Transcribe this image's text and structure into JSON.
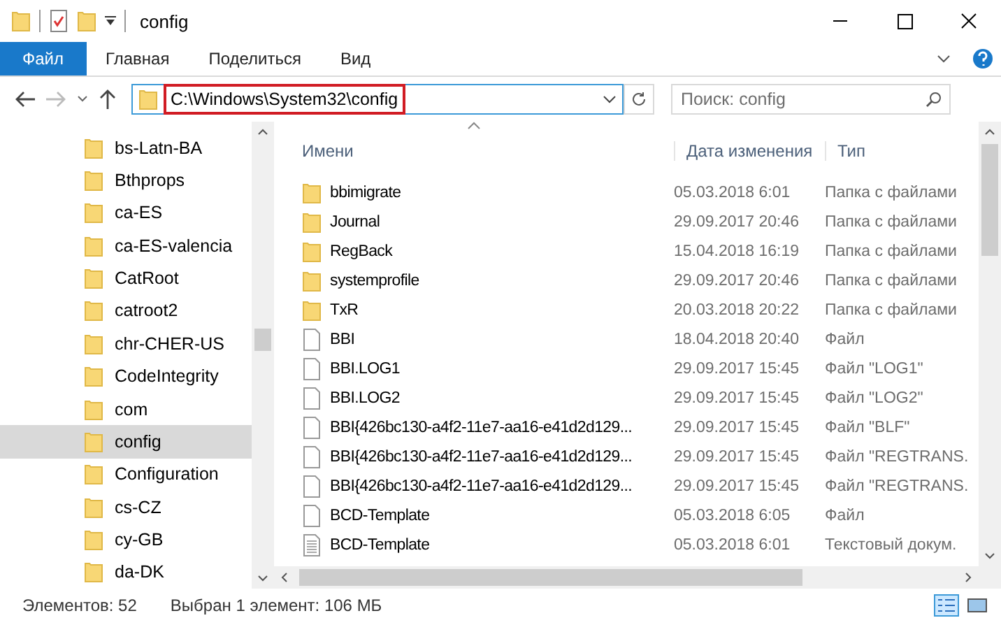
{
  "window": {
    "title": "config"
  },
  "ribbon_tabs": [
    {
      "label": "Файл",
      "selected": true
    },
    {
      "label": "Главная",
      "selected": false
    },
    {
      "label": "Поделиться",
      "selected": false
    },
    {
      "label": "Вид",
      "selected": false
    }
  ],
  "address": {
    "path": "C:\\Windows\\System32\\config",
    "highlighted": true
  },
  "search": {
    "placeholder": "Поиск: config"
  },
  "sidebar": {
    "items": [
      {
        "label": "bs-Latn-BA",
        "selected": false
      },
      {
        "label": "Bthprops",
        "selected": false
      },
      {
        "label": "ca-ES",
        "selected": false
      },
      {
        "label": "ca-ES-valencia",
        "selected": false
      },
      {
        "label": "CatRoot",
        "selected": false
      },
      {
        "label": "catroot2",
        "selected": false
      },
      {
        "label": "chr-CHER-US",
        "selected": false
      },
      {
        "label": "CodeIntegrity",
        "selected": false
      },
      {
        "label": "com",
        "selected": false
      },
      {
        "label": "config",
        "selected": true
      },
      {
        "label": "Configuration",
        "selected": false
      },
      {
        "label": "cs-CZ",
        "selected": false
      },
      {
        "label": "cy-GB",
        "selected": false
      },
      {
        "label": "da-DK",
        "selected": false
      }
    ]
  },
  "table": {
    "columns": [
      "Имени",
      "Дата изменения",
      "Тип"
    ],
    "rows": [
      {
        "kind": "folder",
        "name": "bbimigrate",
        "date": "05.03.2018 6:01",
        "type": "Папка с файлами"
      },
      {
        "kind": "folder",
        "name": "Journal",
        "date": "29.09.2017 20:46",
        "type": "Папка с файлами"
      },
      {
        "kind": "folder",
        "name": "RegBack",
        "date": "15.04.2018 16:19",
        "type": "Папка с файлами"
      },
      {
        "kind": "folder",
        "name": "systemprofile",
        "date": "29.09.2017 20:46",
        "type": "Папка с файлами"
      },
      {
        "kind": "folder",
        "name": "TxR",
        "date": "20.03.2018 20:22",
        "type": "Папка с файлами"
      },
      {
        "kind": "file",
        "name": "BBI",
        "date": "18.04.2018 20:40",
        "type": "Файл"
      },
      {
        "kind": "file",
        "name": "BBI.LOG1",
        "date": "29.09.2017 15:45",
        "type": "Файл \"LOG1\""
      },
      {
        "kind": "file",
        "name": "BBI.LOG2",
        "date": "29.09.2017 15:45",
        "type": "Файл \"LOG2\""
      },
      {
        "kind": "file",
        "name": "BBI{426bc130-a4f2-11e7-aa16-e41d2d129...",
        "date": "29.09.2017 15:45",
        "type": "Файл \"BLF\""
      },
      {
        "kind": "file",
        "name": "BBI{426bc130-a4f2-11e7-aa16-e41d2d129...",
        "date": "29.09.2017 15:45",
        "type": "Файл \"REGTRANS."
      },
      {
        "kind": "file",
        "name": "BBI{426bc130-a4f2-11e7-aa16-e41d2d129...",
        "date": "29.09.2017 15:45",
        "type": "Файл \"REGTRANS."
      },
      {
        "kind": "file",
        "name": "BCD-Template",
        "date": "05.03.2018 6:05",
        "type": "Файл"
      },
      {
        "kind": "text",
        "name": "BCD-Template",
        "date": "05.03.2018 6:01",
        "type": "Текстовый докум."
      }
    ]
  },
  "status_bar": {
    "count": "Элементов: 52",
    "selection": "Выбран 1 элемент: 106 МБ"
  }
}
